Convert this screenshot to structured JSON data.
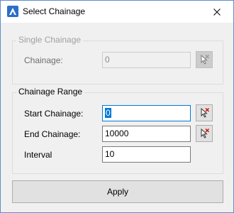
{
  "window": {
    "title": "Select Chainage",
    "close_glyph": "✕"
  },
  "single_chainage": {
    "legend": "Single Chainage",
    "chainage_label": "Chainage:",
    "chainage_value": "0",
    "enabled": false
  },
  "chainage_range": {
    "legend": "Chainage Range",
    "start_label": "Start Chainage:",
    "start_value": "0",
    "end_label": "End Chainage:",
    "end_value": "10000",
    "interval_label": "Interval",
    "interval_value": "10"
  },
  "apply_label": "Apply",
  "icons": {
    "app": "app-logo-icon",
    "pick": "pick-chainage-icon",
    "close": "close-icon"
  },
  "colors": {
    "window_border": "#5e8ec9",
    "dialog_background": "#f0f0f0",
    "focus_accent": "#0078d7",
    "app_icon_blue": "#2a6fc9",
    "pick_icon_red": "#d01010"
  }
}
